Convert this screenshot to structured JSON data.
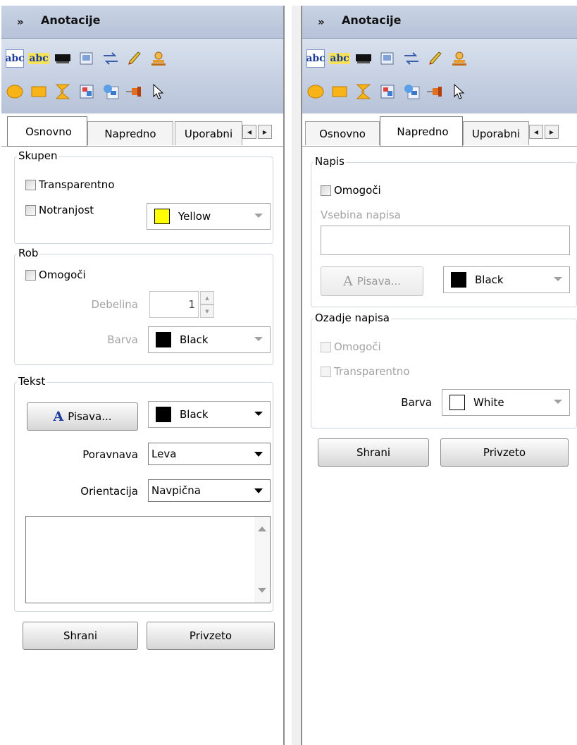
{
  "left": {
    "title": "Anotacije",
    "tabs": [
      "Osnovno",
      "Napredno",
      "Uporabni"
    ],
    "skupen": {
      "label": "Skupen",
      "transparent": "Transparentno",
      "interior": "Notranjost",
      "interior_color": {
        "name": "Yellow",
        "hex": "#ffff00"
      }
    },
    "rob": {
      "label": "Rob",
      "enable": "Omogoči",
      "thickness_label": "Debelina",
      "thickness_value": "1",
      "color_label": "Barva",
      "color": {
        "name": "Black",
        "hex": "#000000"
      }
    },
    "tekst": {
      "label": "Tekst",
      "font_button": "Pisava...",
      "color": {
        "name": "Black",
        "hex": "#000000"
      },
      "align_label": "Poravnava",
      "align_value": "Leva",
      "orient_label": "Orientacija",
      "orient_value": "Navpična"
    },
    "buttons": {
      "save": "Shrani",
      "default": "Privzeto"
    }
  },
  "right": {
    "title": "Anotacije",
    "tabs": [
      "Osnovno",
      "Napredno",
      "Uporabni"
    ],
    "napis": {
      "label": "Napis",
      "enable": "Omogoči",
      "content_label": "Vsebina napisa",
      "font_button": "Pisava...",
      "color": {
        "name": "Black",
        "hex": "#000000"
      }
    },
    "ozadje": {
      "label": "Ozadje napisa",
      "enable": "Omogoči",
      "transparent": "Transparentno",
      "color_label": "Barva",
      "color": {
        "name": "White",
        "hex": "#ffffff"
      }
    },
    "buttons": {
      "save": "Shrani",
      "default": "Privzeto"
    }
  },
  "toolbar_icons": {
    "row1": [
      "text-abc-icon",
      "highlight-text-icon",
      "strikeout-icon",
      "note-icon",
      "link-icon",
      "pencil-icon",
      "stamp-icon"
    ],
    "row2": [
      "ellipse-icon",
      "rectangle-icon",
      "polygon-icon",
      "image-icon",
      "attachment-icon",
      "pushpin-icon",
      "select-pointer-icon"
    ]
  },
  "colors": {
    "title_bg": "#c2cde0",
    "accent": "#1d3d9c",
    "yellow": "#ffff00"
  }
}
